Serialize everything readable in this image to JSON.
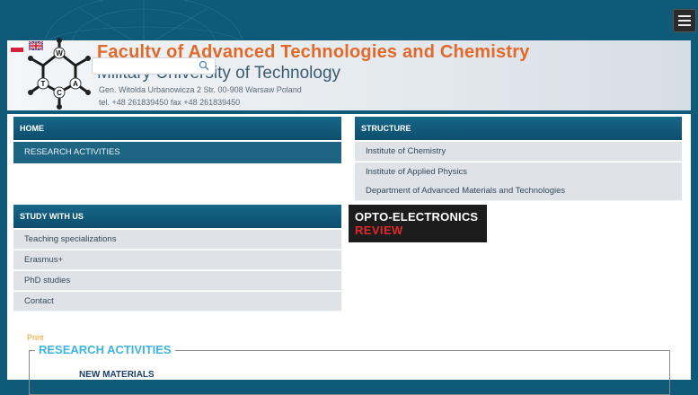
{
  "header": {
    "title": "Faculty of Advanced Technologies and Chemistry",
    "subtitle": "Military University of Technology",
    "address": "Gen. Witolda Urbanowicza 2 Str. 00-908 Warsaw Poland",
    "tel": "tel. +48 261839450  fax +48 261839450",
    "search_placeholder": ""
  },
  "logo_letters": [
    "W",
    "A",
    "T",
    "C"
  ],
  "menus": {
    "home": "HOME",
    "research": "RESEARCH ACTIVITIES",
    "structure": {
      "title": "STRUCTURE",
      "items": [
        "Institute of Chemistry",
        "Institute of Applied Physics",
        "Department of Advanced Materials and Technologies"
      ]
    },
    "study": {
      "title": "STUDY WITH US",
      "items": [
        "Teaching specializations",
        "Erasmus+",
        "PhD studies",
        "Contact"
      ]
    }
  },
  "banner": {
    "line1": "OPTO-ELECTRONICS",
    "line2": "REVIEW"
  },
  "article": {
    "print_label": "Print",
    "section_title": "RESEARCH ACTIVITIES",
    "heading": "NEW MATERIALS"
  }
}
